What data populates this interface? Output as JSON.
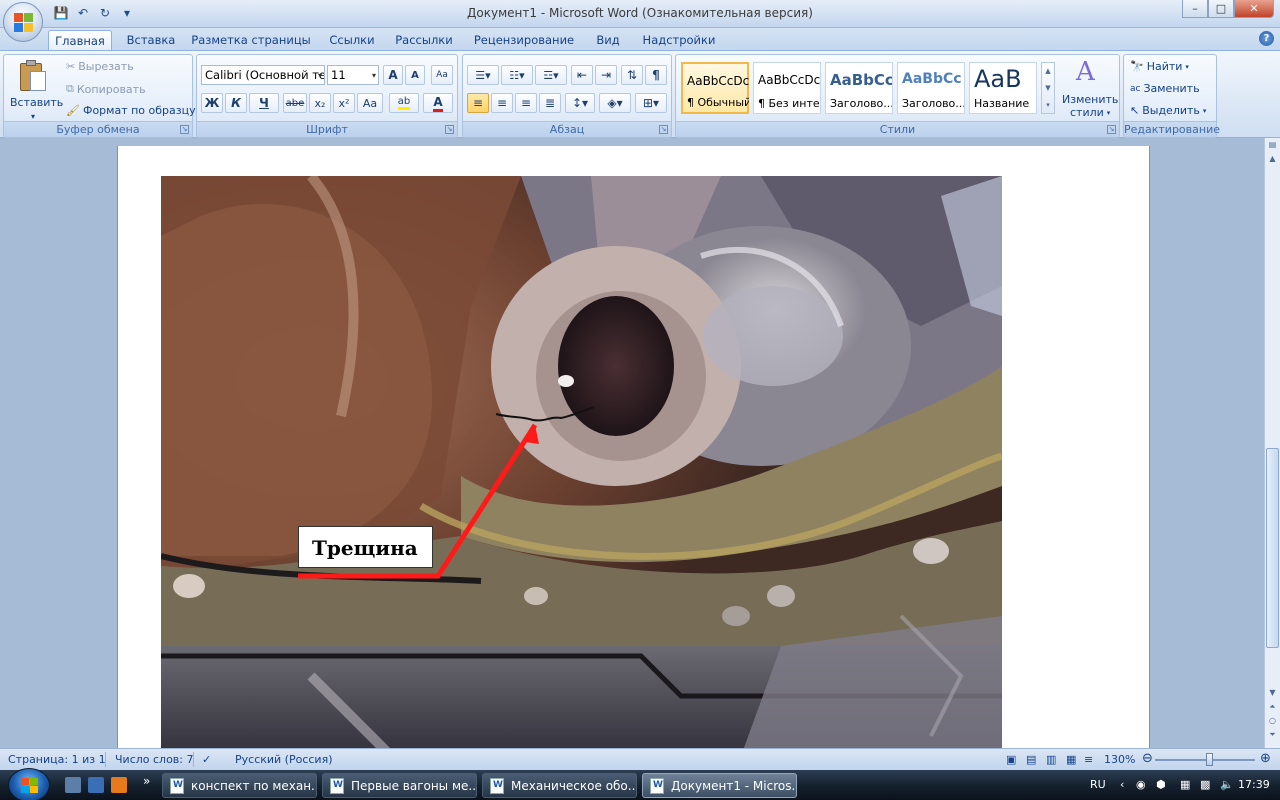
{
  "window": {
    "title": "Документ1 - Microsoft Word (Ознакомительная версия)",
    "controls": [
      "–",
      "□",
      "✕"
    ]
  },
  "qat": {
    "save": "💾",
    "undo": "↶",
    "redo": "↻",
    "customize": "▾"
  },
  "tabs": [
    "Главная",
    "Вставка",
    "Разметка страницы",
    "Ссылки",
    "Рассылки",
    "Рецензирование",
    "Вид",
    "Надстройки"
  ],
  "active_tab": "Главная",
  "help": "?",
  "ribbon": {
    "clipboard": {
      "label": "Буфер обмена",
      "paste": "Вставить",
      "cut": "Вырезать",
      "copy": "Копировать",
      "format_painter": "Формат по образцу"
    },
    "font": {
      "label": "Шрифт",
      "font_name": "Calibri (Основной те",
      "font_size": "11",
      "grow": "A",
      "shrink": "A",
      "clear": "Aa",
      "bold": "Ж",
      "italic": "К",
      "underline": "Ч",
      "strike": "abe",
      "subscript": "x₂",
      "superscript": "x²",
      "case": "Aa",
      "highlight": "ab",
      "color": "A"
    },
    "paragraph": {
      "label": "Абзац",
      "pilcrow": "¶"
    },
    "styles": {
      "label": "Стили",
      "items": [
        {
          "sample": "AaBbCcDc",
          "name": "¶ Обычный"
        },
        {
          "sample": "AaBbCcDc",
          "name": "¶ Без инте..."
        },
        {
          "sample": "AaBbCc",
          "name": "Заголово..."
        },
        {
          "sample": "AaBbCc",
          "name": "Заголово..."
        },
        {
          "sample": "AaB",
          "name": "Название"
        }
      ],
      "change_styles_line1": "Изменить",
      "change_styles_line2": "стили"
    },
    "editing": {
      "label": "Редактирование",
      "find": "Найти",
      "replace": "Заменить",
      "select": "Выделить"
    }
  },
  "document": {
    "callout_text": "Трещина"
  },
  "status": {
    "page": "Страница: 1 из 1",
    "words": "Число слов: 7",
    "language": "Русский (Россия)",
    "zoom": "130%"
  },
  "taskbar": {
    "items": [
      "конспект по механ...",
      "Первые вагоны ме...",
      "Механическое обо...",
      "Документ1 - Micros..."
    ],
    "lang": "RU",
    "clock": "17:39"
  },
  "colors": {
    "ribbon_text": "#15428b",
    "callout_arrow": "#ff1a1a",
    "selected_style": "#f2b84b"
  }
}
